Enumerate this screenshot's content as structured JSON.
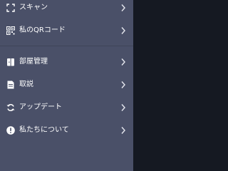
{
  "colors": {
    "drawer_background": "#4a5068",
    "backdrop": "#151922",
    "text": "#ffffff",
    "chevron": "#e6e8ef"
  },
  "menu": {
    "top_items": [
      {
        "label": "スキャン",
        "icon": "scan-icon"
      },
      {
        "label": "私のQRコード",
        "icon": "qr-code-icon"
      }
    ],
    "bottom_items": [
      {
        "label": "部屋管理",
        "icon": "door-icon"
      },
      {
        "label": "取説",
        "icon": "document-icon"
      },
      {
        "label": "アップデート",
        "icon": "refresh-icon"
      },
      {
        "label": "私たちについて",
        "icon": "info-icon"
      }
    ]
  }
}
